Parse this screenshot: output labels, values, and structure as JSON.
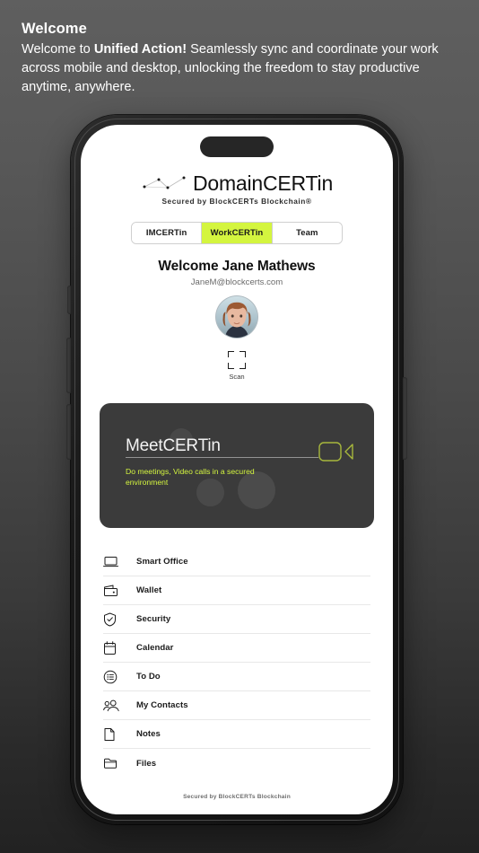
{
  "header": {
    "title": "Welcome",
    "body_pre": "Welcome to ",
    "body_bold": "Unified Action!",
    "body_post": " Seamlessly sync and coordinate your work across mobile and desktop, unlocking the freedom to stay productive anytime, anywhere."
  },
  "app": {
    "logo_text": "DomainCERTin",
    "logo_sub": "Secured by BlockCERTs Blockchain®",
    "logo_mark_icon": "network-constellation-icon"
  },
  "tabs": [
    {
      "label": "IMCERTin",
      "active": false
    },
    {
      "label": "WorkCERTin",
      "active": true
    },
    {
      "label": "Team",
      "active": false
    }
  ],
  "profile": {
    "welcome_name": "Welcome Jane Mathews",
    "email": "JaneM@blockcerts.com",
    "avatar_icon": "user-avatar-photo"
  },
  "scan": {
    "label": "Scan",
    "icon": "scan-frame-icon"
  },
  "meet_card": {
    "title": "MeetCERTin",
    "subtitle": "Do meetings, Video calls in a secured environment",
    "icon": "video-camera-icon"
  },
  "menu": [
    {
      "label": "Smart Office",
      "icon": "laptop-icon"
    },
    {
      "label": "Wallet",
      "icon": "wallet-icon"
    },
    {
      "label": "Security",
      "icon": "shield-check-icon"
    },
    {
      "label": "Calendar",
      "icon": "calendar-icon"
    },
    {
      "label": "To Do",
      "icon": "checklist-circle-icon"
    },
    {
      "label": "My Contacts",
      "icon": "people-icon"
    },
    {
      "label": "Notes",
      "icon": "note-page-icon"
    },
    {
      "label": "Files",
      "icon": "folder-icon"
    }
  ],
  "footer": {
    "text": "Secured by BlockCERTs Blockchain"
  },
  "colors": {
    "accent": "#d4f53f",
    "card_bg": "#3b3b3b",
    "text_dark": "#111111",
    "page_bg_top": "#5f5f5f",
    "page_bg_bottom": "#222222"
  }
}
